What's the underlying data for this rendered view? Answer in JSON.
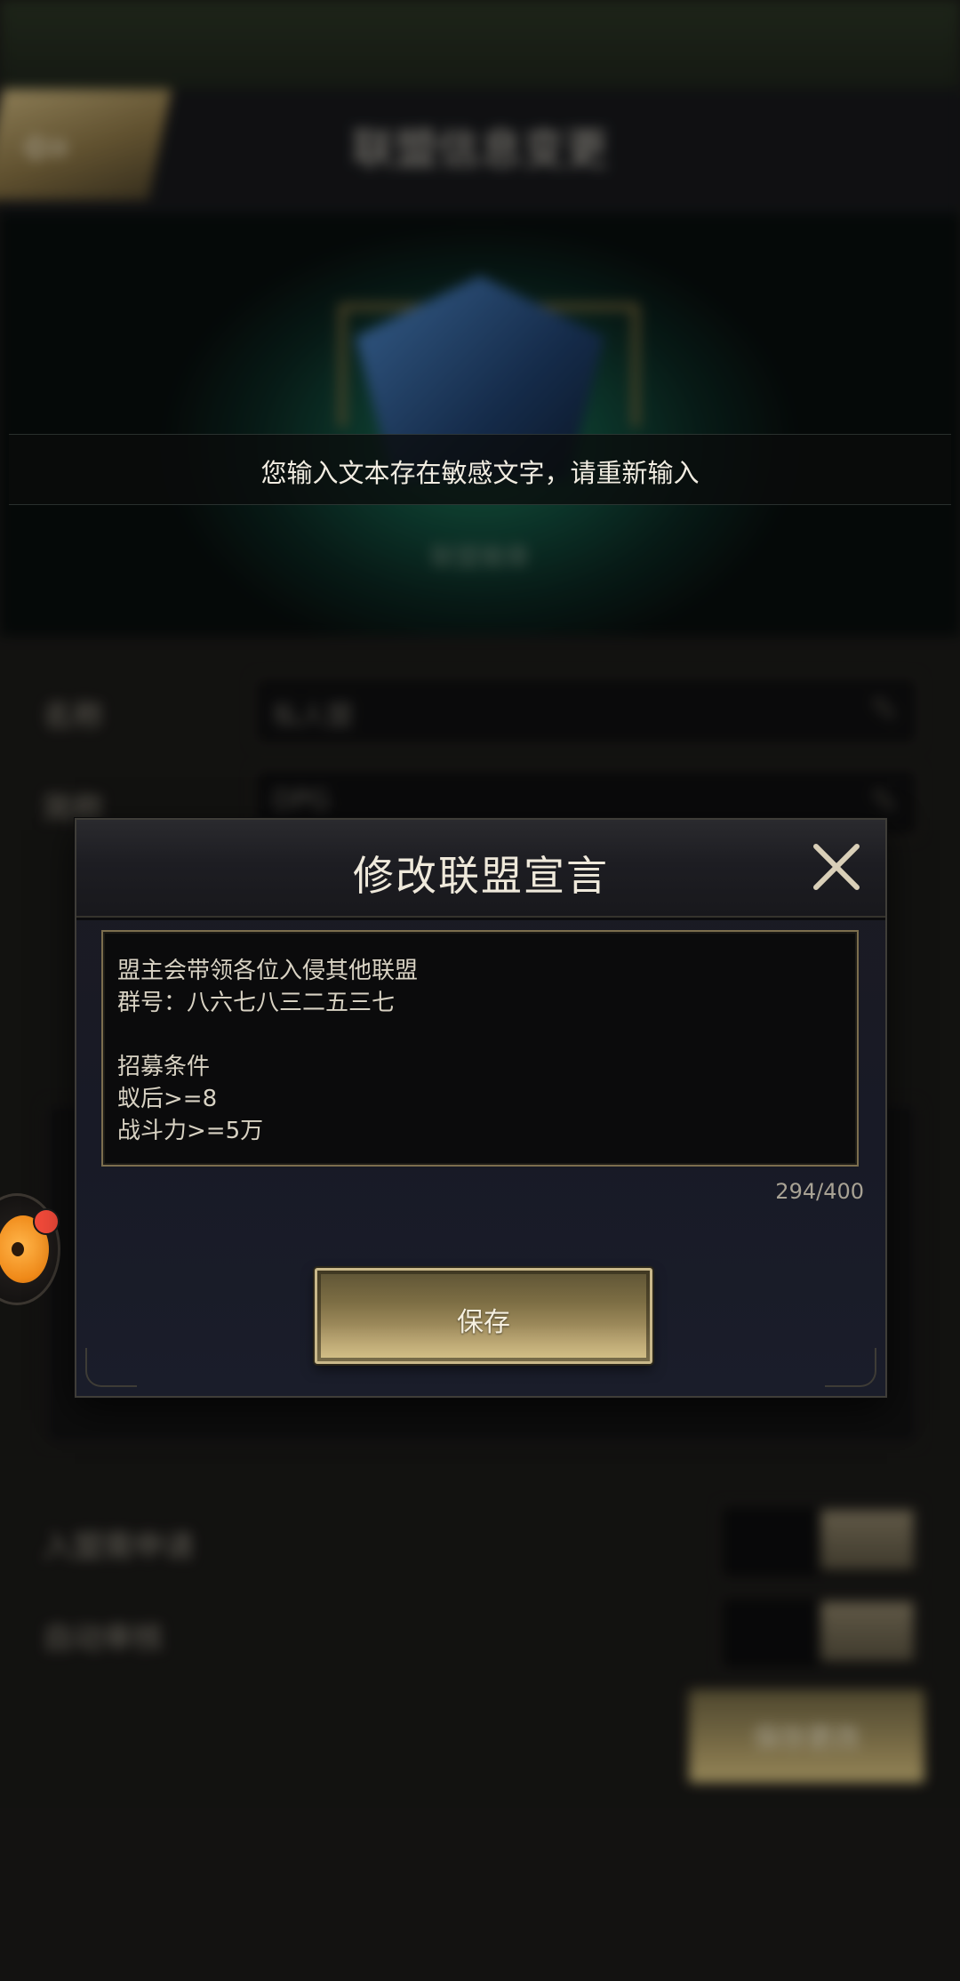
{
  "background": {
    "header_title": "联盟信息变更",
    "banner_subtitle": "联盟徽章",
    "form": [
      {
        "label": "名称",
        "value": "私人盟"
      },
      {
        "label": "简称",
        "value": "DPG"
      }
    ],
    "toggles": [
      {
        "label": "入盟需申请"
      },
      {
        "label": "自动审核"
      }
    ],
    "bottom_button_label": "保存更改"
  },
  "toast": {
    "message": "您输入文本存在敏感文字，请重新输入"
  },
  "dialog": {
    "title": "修改联盟宣言",
    "declaration_lines": [
      "盟主会带领各位入侵其他联盟",
      "群号：八六七八三二五三七",
      "",
      "招募条件",
      "蚁后>=8",
      "战斗力>=5万"
    ],
    "char_count": "294/400",
    "save_label": "保存"
  },
  "icons": {
    "close": "close-icon",
    "back": "back-arrow-icon",
    "edit": "pencil-icon",
    "assistant": "assistant-mascot-icon"
  },
  "colors": {
    "accent_gold": "#c9b88a",
    "notify_red": "#f24a3a"
  }
}
